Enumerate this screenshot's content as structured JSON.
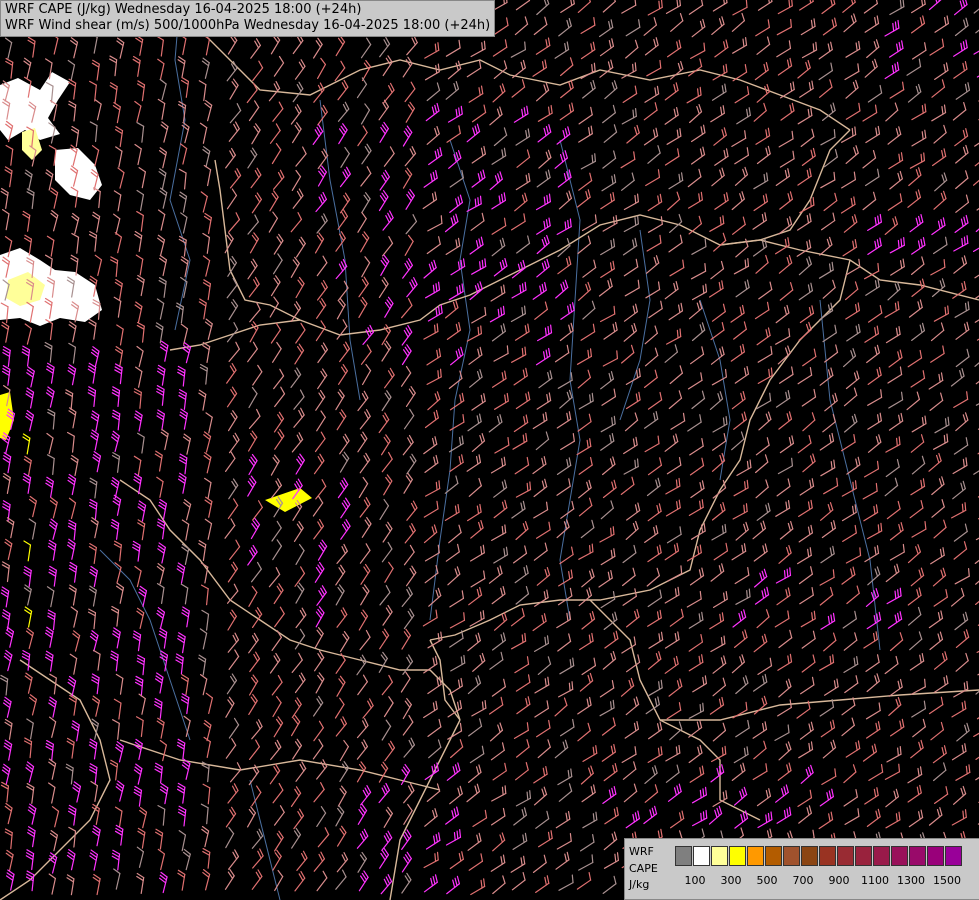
{
  "header": {
    "line1": "WRF CAPE (J/kg) Wednesday 16-04-2025 18:00 (+24h)",
    "line2": "WRF Wind shear (m/s) 500/1000hPa Wednesday 16-04-2025 18:00 (+24h)"
  },
  "legend": {
    "label_top": "WRF",
    "label_mid": "CAPE",
    "label_unit": "J/kg",
    "colors": [
      "#7f7f7f",
      "#ffffff",
      "#ffff99",
      "#ffff00",
      "#ff9900",
      "#b35c00",
      "#a0522d",
      "#8b4513",
      "#993322",
      "#992b33",
      "#99223d",
      "#991a4a",
      "#99115a",
      "#990a6a",
      "#99007a",
      "#990099"
    ],
    "ticks": [
      {
        "value": "100",
        "index": 1
      },
      {
        "value": "300",
        "index": 3
      },
      {
        "value": "500",
        "index": 5
      },
      {
        "value": "700",
        "index": 7
      },
      {
        "value": "900",
        "index": 9
      },
      {
        "value": "1100",
        "index": 11
      },
      {
        "value": "1300",
        "index": 13
      },
      {
        "value": "1500",
        "index": 15
      }
    ]
  },
  "barb_colors": {
    "light": "#d98c8c",
    "medium": "#e07070",
    "grey": "#a89090",
    "strong": "#ff33ff",
    "cape_low": "#ffff00"
  },
  "map_colors": {
    "background": "#000000",
    "border": "#d8b89a",
    "river": "#4a6fa0",
    "cape_area": "#ffffff"
  }
}
